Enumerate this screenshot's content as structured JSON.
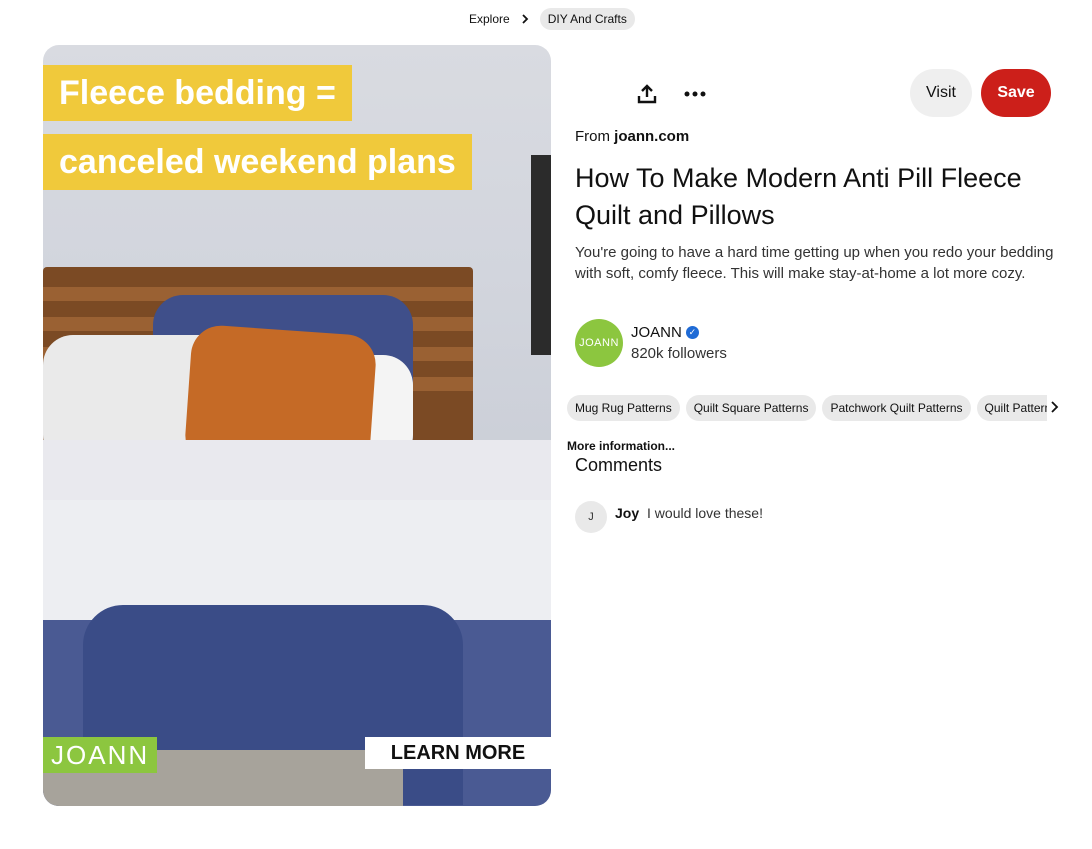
{
  "breadcrumb": {
    "explore": "Explore",
    "category": "DIY And Crafts"
  },
  "pin_image": {
    "headline_line1": "Fleece bedding =",
    "headline_line2": "canceled weekend plans",
    "brand": "JOANN",
    "cta": "LEARN MORE"
  },
  "actions": {
    "visit": "Visit",
    "save": "Save"
  },
  "source": {
    "prefix": "From",
    "domain": "joann.com"
  },
  "title": "How To Make Modern Anti Pill Fleece Quilt and Pillows",
  "description": "You're going to have a hard time getting up when you redo your bedding with soft, comfy fleece. This will make stay-at-home a lot more cozy.",
  "author": {
    "avatar_text": "JOANN",
    "name": "JOANN",
    "followers": "820k followers"
  },
  "tags": [
    "Mug Rug Patterns",
    "Quilt Square Patterns",
    "Patchwork Quilt Patterns",
    "Quilt Patterns"
  ],
  "more_info": "More information...",
  "comments": {
    "heading": "Comments",
    "items": [
      {
        "avatar": "J",
        "author": "Joy",
        "text": "I would love these!"
      }
    ]
  },
  "colors": {
    "save": "#cc1f1a",
    "brand_green": "#8cc63f",
    "headline_yellow": "#f0c93b"
  }
}
